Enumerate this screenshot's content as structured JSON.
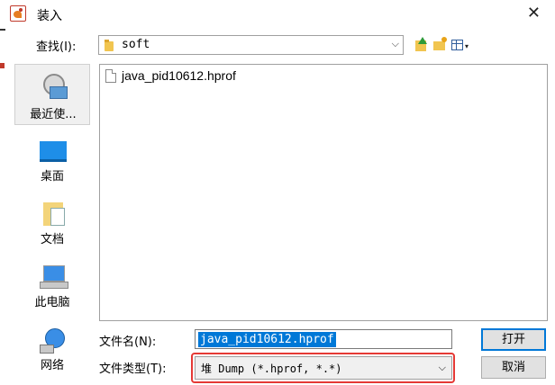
{
  "window": {
    "title": "装入",
    "close_glyph": "✕"
  },
  "toolbar": {
    "lookin_label": "查找(I):",
    "lookin_value": "soft",
    "combo_arrow": "⌵",
    "view_caret": "▾"
  },
  "places": [
    {
      "label": "最近使...",
      "icon": "recent-places-icon"
    },
    {
      "label": "桌面",
      "icon": "desktop-icon"
    },
    {
      "label": "文档",
      "icon": "documents-icon"
    },
    {
      "label": "此电脑",
      "icon": "this-pc-icon"
    },
    {
      "label": "网络",
      "icon": "network-icon"
    }
  ],
  "files": [
    {
      "name": "java_pid10612.hprof",
      "icon": "file-icon"
    }
  ],
  "form": {
    "filename_label": "文件名(N):",
    "filename_value": "java_pid10612.hprof",
    "filetype_label": "文件类型(T):",
    "filetype_value": "堆 Dump (*.hprof, *.*)",
    "filetype_arrow": "⌵"
  },
  "buttons": {
    "open": "打开",
    "cancel": "取消"
  },
  "colors": {
    "selection": "#0078d7",
    "highlight_box": "#e53935",
    "accent": "#0078d7"
  }
}
